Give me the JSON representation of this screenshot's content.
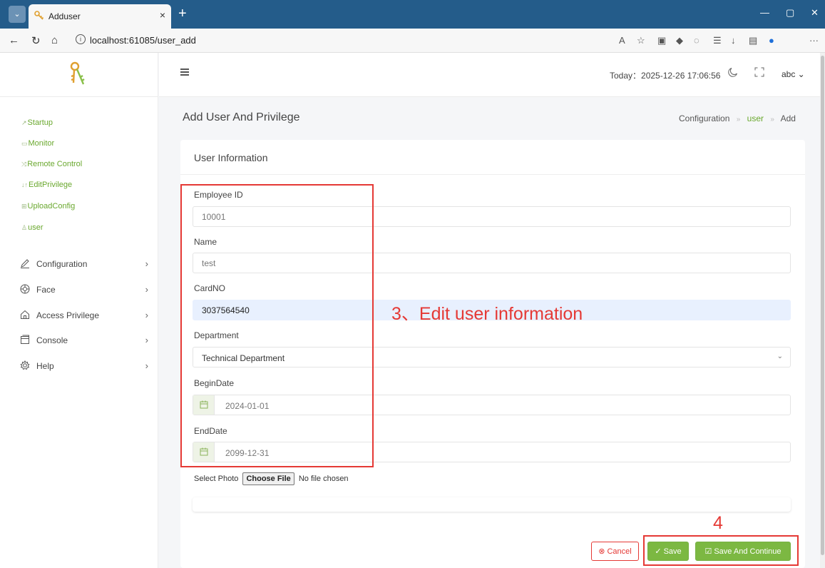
{
  "browser": {
    "tab_title": "Adduser",
    "url": "localhost:61085/user_add",
    "new_tab": "+",
    "tab_close": "×"
  },
  "sidebar": {
    "sub_items": [
      {
        "icon": "↗",
        "label": "Startup"
      },
      {
        "icon": "▭",
        "label": "Monitor"
      },
      {
        "icon": "⤨",
        "label": "Remote Control"
      },
      {
        "icon": "↓↑",
        "label": "EditPrivilege"
      },
      {
        "icon": "⊞",
        "label": "UploadConfig"
      },
      {
        "icon": "♙",
        "label": "user"
      }
    ],
    "menu": [
      {
        "icon": "pencil-icon",
        "label": "Configuration",
        "arrow": "›"
      },
      {
        "icon": "face-icon",
        "label": "Face",
        "arrow": "›"
      },
      {
        "icon": "home-icon",
        "label": "Access Privilege",
        "arrow": "›"
      },
      {
        "icon": "console-icon",
        "label": "Console",
        "arrow": "›"
      },
      {
        "icon": "gear-icon",
        "label": "Help",
        "arrow": "›"
      }
    ]
  },
  "header": {
    "today": "Today：2025-12-26 17:06:56",
    "user": "abc ⌄"
  },
  "page": {
    "title": "Add User And Privilege",
    "breadcrumb": [
      "Configuration",
      "user",
      "Add"
    ],
    "breadcrumb_sep": "»",
    "card_title": "User Information"
  },
  "form": {
    "employee_id_label": "Employee ID",
    "employee_id_value": "10001",
    "name_label": "Name",
    "name_value": "test",
    "cardno_label": "CardNO",
    "cardno_value": "3037564540",
    "department_label": "Department",
    "department_value": "Technical Department",
    "begin_label": "BeginDate",
    "begin_value": "2024-01-01",
    "end_label": "EndDate",
    "end_value": "2099-12-31",
    "photo_label": "Select Photo",
    "choose_file": "Choose File",
    "no_file": "No file chosen"
  },
  "buttons": {
    "cancel": "Cancel",
    "save": "Save",
    "save_continue": "Save And Continue"
  },
  "annotations": {
    "step3": "3、Edit user information",
    "step4": "4",
    "color": "#e53935"
  },
  "colors": {
    "accent": "#7cb842",
    "chrome": "#245c8a"
  }
}
